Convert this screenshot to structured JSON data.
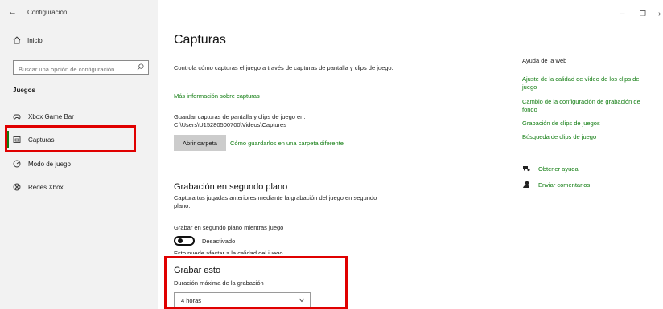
{
  "window": {
    "back_glyph": "←",
    "title": "Configuración",
    "minimize_glyph": "–",
    "restore_glyph": "❐",
    "close_glyph": "›"
  },
  "sidebar": {
    "home_label": "Inicio",
    "search_placeholder": "Buscar una opción de configuración",
    "section_label": "Juegos",
    "items": [
      {
        "label": "Xbox Game Bar",
        "icon": "xbox-game-bar-icon"
      },
      {
        "label": "Capturas",
        "icon": "captures-icon",
        "selected": true
      },
      {
        "label": "Modo de juego",
        "icon": "game-mode-icon"
      },
      {
        "label": "Redes Xbox",
        "icon": "xbox-networking-icon"
      }
    ]
  },
  "main": {
    "title": "Capturas",
    "description": "Controla cómo capturas el juego a través de capturas de pantalla y clips de juego.",
    "more_info_link": "Más información sobre capturas",
    "save_path_text": "Guardar capturas de pantalla y clips de juego en: C:\\Users\\U15280500700\\Videos\\Captures",
    "open_folder_button": "Abrir carpeta",
    "save_help_link": "Cómo guardarlos en una carpeta diferente",
    "background": {
      "heading": "Grabación en segundo plano",
      "description": "Captura tus jugadas anteriores mediante la grabación del juego en segundo plano.",
      "toggle_label": "Grabar en segundo plano mientras juego",
      "toggle_state": "Desactivado",
      "toggle_on": false,
      "note": "Esto puede afectar a la calidad del juego."
    },
    "record_this": {
      "heading": "Grabar esto",
      "duration_label": "Duración máxima de la grabación",
      "duration_value": "4 horas"
    }
  },
  "right": {
    "heading": "Ayuda de la web",
    "links": [
      "Ajuste de la calidad de vídeo de los clips de juego",
      "Cambio de la configuración de grabación de fondo",
      "Grabación de clips de juegos",
      "Búsqueda de clips de juego"
    ],
    "get_help": "Obtener ayuda",
    "feedback": "Enviar comentarios"
  },
  "colors": {
    "accent": "#107c10",
    "highlight": "#e00000",
    "sidebar_bg": "#f2f2f2"
  }
}
